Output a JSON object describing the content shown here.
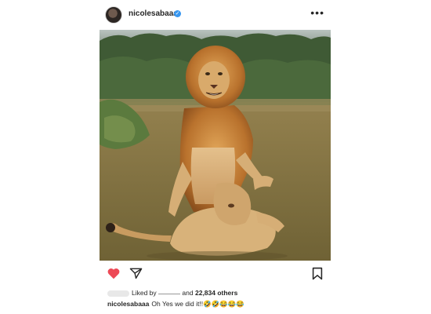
{
  "post": {
    "username": "nicolesabaaa",
    "verified_icon": "verified-badge-icon",
    "more_icon": "more-options-icon"
  },
  "actions": {
    "like_icon": "heart-icon",
    "like_color": "#ed4956",
    "share_icon": "direct-share-icon",
    "save_icon": "bookmark-icon"
  },
  "likes": {
    "prefix": "Liked by",
    "connector": "and",
    "count": "22,834 others"
  },
  "caption": {
    "username": "nicolesabaaa",
    "text": "Oh Yes we did it!!🤣🤣😂😂😂"
  }
}
